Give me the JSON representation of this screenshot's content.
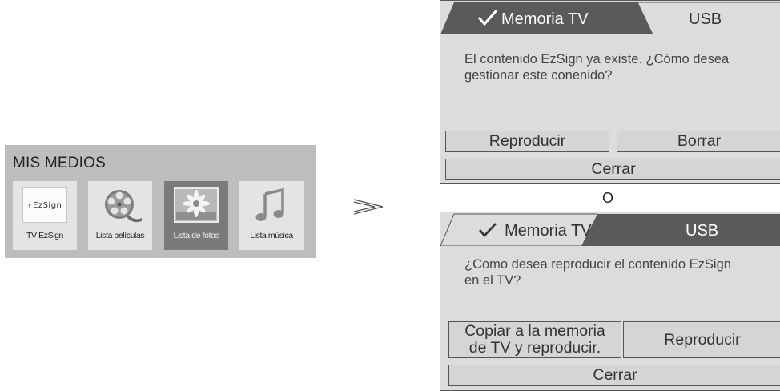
{
  "media_menu": {
    "title": "MIS MEDIOS",
    "items": [
      {
        "label": "TV EzSign",
        "icon": "ezsign-logo",
        "thumb_text": "EzSign",
        "selected": false
      },
      {
        "label": "Lista películas",
        "icon": "film-reel-icon",
        "selected": false
      },
      {
        "label": "Lista de fotos",
        "icon": "photo-flower-icon",
        "selected": true
      },
      {
        "label": "Lista música",
        "icon": "music-note-icon",
        "selected": false
      }
    ]
  },
  "arrow_icon": "double-chevron-right-icon",
  "dialog_1": {
    "tabs": [
      {
        "label": "Memoria TV",
        "checked": true,
        "active": true
      },
      {
        "label": "USB",
        "checked": false,
        "active": false
      }
    ],
    "message": "El contenido EzSign ya existe. ¿Cómo desea gestionar este conenido?",
    "buttons": {
      "play": "Reproducir",
      "delete": "Borrar",
      "close": "Cerrar"
    }
  },
  "separator": "O",
  "dialog_2": {
    "tabs": [
      {
        "label": "Memoria TV",
        "checked": true,
        "active": false
      },
      {
        "label": "USB",
        "checked": false,
        "active": true
      }
    ],
    "message": "¿Como desea reproducir el contenido EzSign en el TV?",
    "buttons": {
      "copy_line1": "Copiar a la memoria",
      "copy_line2": "de TV y reproducir.",
      "play": "Reproducir",
      "close": "Cerrar"
    }
  },
  "colors": {
    "active_tab": "#5a5a5a",
    "inactive_tab": "#dcdcdc",
    "panel": "#bdbdbd",
    "selected_tile": "#7a7a7a"
  }
}
